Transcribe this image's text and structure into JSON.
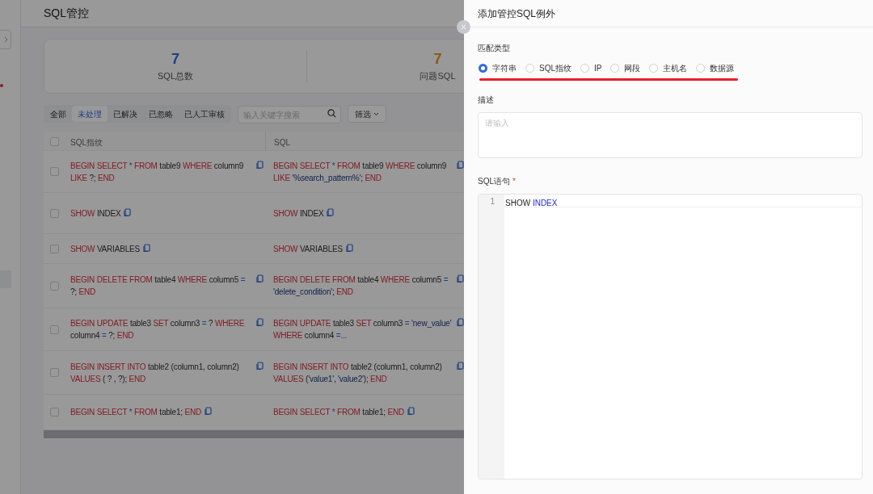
{
  "page": {
    "title": "SQL管控"
  },
  "stats": [
    {
      "value": "7",
      "label": "SQL总数",
      "kind": "total"
    },
    {
      "value": "7",
      "label": "问题SQL",
      "kind": "problem"
    }
  ],
  "filter_tabs": [
    {
      "label": "全部",
      "selected": false
    },
    {
      "label": "未处理",
      "selected": true
    },
    {
      "label": "已解决",
      "selected": false
    },
    {
      "label": "已忽略",
      "selected": false
    },
    {
      "label": "已人工审核",
      "selected": false
    }
  ],
  "search": {
    "placeholder": "输入关键字搜索"
  },
  "filter_button": {
    "label": "筛选"
  },
  "table": {
    "checked": false,
    "columns": [
      "SQL指纹",
      "SQL"
    ],
    "rows": [
      {
        "checked": false,
        "cells": [
          [
            {
              "kind": "kw",
              "text": "BEGIN SELECT"
            },
            {
              "kind": "op",
              "text": " * "
            },
            {
              "kind": "kw",
              "text": "FROM"
            },
            {
              "kind": "id",
              "text": " table9 "
            },
            {
              "kind": "kw",
              "text": "WHERE"
            },
            {
              "kind": "id",
              "text": " column9 "
            },
            {
              "kind": "kw",
              "text": "LIKE"
            },
            {
              "kind": "id",
              "text": " ?; "
            },
            {
              "kind": "kw",
              "text": "END"
            }
          ],
          [
            {
              "kind": "kw",
              "text": "BEGIN SELECT"
            },
            {
              "kind": "op",
              "text": " * "
            },
            {
              "kind": "kw",
              "text": "FROM"
            },
            {
              "kind": "id",
              "text": " table9 "
            },
            {
              "kind": "kw",
              "text": "WHERE"
            },
            {
              "kind": "id",
              "text": " column9 "
            },
            {
              "kind": "kw",
              "text": "LIKE"
            },
            {
              "kind": "id",
              "text": " "
            },
            {
              "kind": "str",
              "text": "'%search_pattern%'"
            },
            {
              "kind": "id",
              "text": "; "
            },
            {
              "kind": "kw",
              "text": "END"
            }
          ]
        ]
      },
      {
        "checked": false,
        "cells": [
          [
            {
              "kind": "kw",
              "text": "SHOW"
            },
            {
              "kind": "id",
              "text": " INDEX"
            }
          ],
          [
            {
              "kind": "kw",
              "text": "SHOW"
            },
            {
              "kind": "id",
              "text": " INDEX"
            }
          ]
        ]
      },
      {
        "checked": false,
        "cells": [
          [
            {
              "kind": "kw",
              "text": "SHOW"
            },
            {
              "kind": "id",
              "text": " VARIABLES"
            }
          ],
          [
            {
              "kind": "kw",
              "text": "SHOW"
            },
            {
              "kind": "id",
              "text": " VARIABLES"
            }
          ]
        ]
      },
      {
        "checked": false,
        "cells": [
          [
            {
              "kind": "kw",
              "text": "BEGIN DELETE FROM"
            },
            {
              "kind": "id",
              "text": " table4 "
            },
            {
              "kind": "kw",
              "text": "WHERE"
            },
            {
              "kind": "id",
              "text": " column5 "
            },
            {
              "kind": "op",
              "text": "="
            },
            {
              "kind": "id",
              "text": " ?; "
            },
            {
              "kind": "kw",
              "text": "END"
            }
          ],
          [
            {
              "kind": "kw",
              "text": "BEGIN DELETE FROM"
            },
            {
              "kind": "id",
              "text": " table4 "
            },
            {
              "kind": "kw",
              "text": "WHERE"
            },
            {
              "kind": "id",
              "text": " column5 "
            },
            {
              "kind": "op",
              "text": "="
            },
            {
              "kind": "id",
              "text": " "
            },
            {
              "kind": "str",
              "text": "'delete_condition'"
            },
            {
              "kind": "id",
              "text": "; "
            },
            {
              "kind": "kw",
              "text": "END"
            }
          ]
        ]
      },
      {
        "checked": false,
        "cells": [
          [
            {
              "kind": "kw",
              "text": "BEGIN UPDATE"
            },
            {
              "kind": "id",
              "text": " table3 "
            },
            {
              "kind": "kw",
              "text": "SET"
            },
            {
              "kind": "id",
              "text": " column3 "
            },
            {
              "kind": "op",
              "text": "="
            },
            {
              "kind": "id",
              "text": " ? "
            },
            {
              "kind": "kw",
              "text": "WHERE"
            },
            {
              "kind": "id",
              "text": " column4 "
            },
            {
              "kind": "op",
              "text": "="
            },
            {
              "kind": "id",
              "text": " ?; "
            },
            {
              "kind": "kw",
              "text": "END"
            }
          ],
          [
            {
              "kind": "kw",
              "text": "BEGIN UPDATE"
            },
            {
              "kind": "id",
              "text": " table3 "
            },
            {
              "kind": "kw",
              "text": "SET"
            },
            {
              "kind": "id",
              "text": " column3 "
            },
            {
              "kind": "op",
              "text": "="
            },
            {
              "kind": "id",
              "text": " "
            },
            {
              "kind": "str",
              "text": "'new_value'"
            },
            {
              "kind": "id",
              "text": " "
            },
            {
              "kind": "kw",
              "text": "WHERE"
            },
            {
              "kind": "id",
              "text": " column4 "
            },
            {
              "kind": "op",
              "text": "=..."
            }
          ]
        ]
      },
      {
        "checked": false,
        "cells": [
          [
            {
              "kind": "kw",
              "text": "BEGIN INSERT INTO"
            },
            {
              "kind": "id",
              "text": " table2 (column1, column2) "
            },
            {
              "kind": "kw",
              "text": "VALUES"
            },
            {
              "kind": "id",
              "text": " ( ? , ?); "
            },
            {
              "kind": "kw",
              "text": "END"
            }
          ],
          [
            {
              "kind": "kw",
              "text": "BEGIN INSERT INTO"
            },
            {
              "kind": "id",
              "text": " table2 (column1, column2) "
            },
            {
              "kind": "kw",
              "text": "VALUES"
            },
            {
              "kind": "id",
              "text": " ("
            },
            {
              "kind": "str",
              "text": "'value1'"
            },
            {
              "kind": "id",
              "text": ", "
            },
            {
              "kind": "str",
              "text": "'value2'"
            },
            {
              "kind": "id",
              "text": "); "
            },
            {
              "kind": "kw",
              "text": "END"
            }
          ]
        ]
      },
      {
        "checked": false,
        "cells": [
          [
            {
              "kind": "kw",
              "text": "BEGIN SELECT"
            },
            {
              "kind": "op",
              "text": " * "
            },
            {
              "kind": "kw",
              "text": "FROM"
            },
            {
              "kind": "id",
              "text": " table1; "
            },
            {
              "kind": "kw",
              "text": "END"
            }
          ],
          [
            {
              "kind": "kw",
              "text": "BEGIN SELECT"
            },
            {
              "kind": "op",
              "text": " * "
            },
            {
              "kind": "kw",
              "text": "FROM"
            },
            {
              "kind": "id",
              "text": " table1; "
            },
            {
              "kind": "kw",
              "text": "END"
            }
          ]
        ]
      }
    ]
  },
  "drawer": {
    "title": "添加管控SQL例外",
    "match_type": {
      "label": "匹配类型",
      "options": [
        {
          "label": "字符串",
          "selected": true
        },
        {
          "label": "SQL指纹",
          "selected": false
        },
        {
          "label": "IP",
          "selected": false
        },
        {
          "label": "网段",
          "selected": false
        },
        {
          "label": "主机名",
          "selected": false
        },
        {
          "label": "数据源",
          "selected": false
        }
      ]
    },
    "description": {
      "label": "描述",
      "placeholder": "请输入"
    },
    "sql": {
      "label": "SQL语句",
      "required_mark": "*",
      "lines": [
        {
          "number": "1",
          "tokens": [
            {
              "kind": "plain",
              "text": "SHOW "
            },
            {
              "kind": "keyword",
              "text": "INDEX"
            }
          ]
        }
      ]
    }
  }
}
